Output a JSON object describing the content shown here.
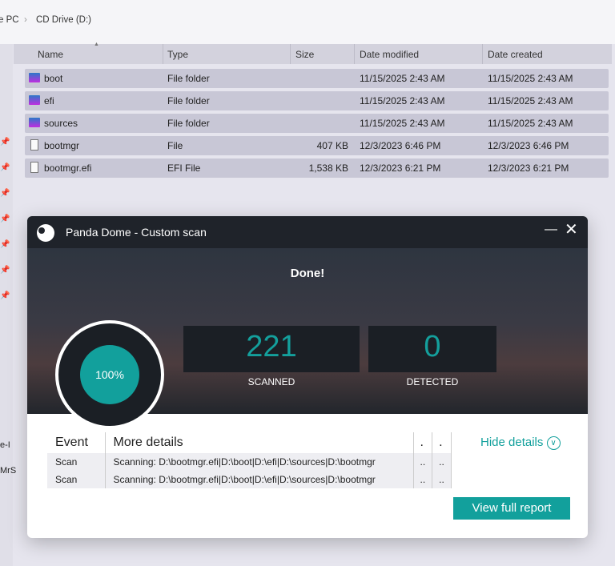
{
  "breadcrumb": [
    "e PC",
    "CD Drive (D:)"
  ],
  "columns": [
    "Name",
    "Type",
    "Size",
    "Date modified",
    "Date created"
  ],
  "files": [
    {
      "name": "boot",
      "type": "File folder",
      "size": "",
      "modified": "11/15/2025 2:43 AM",
      "created": "11/15/2025 2:43 AM",
      "icon": "folder-icon"
    },
    {
      "name": "efi",
      "type": "File folder",
      "size": "",
      "modified": "11/15/2025 2:43 AM",
      "created": "11/15/2025 2:43 AM",
      "icon": "folder-icon"
    },
    {
      "name": "sources",
      "type": "File folder",
      "size": "",
      "modified": "11/15/2025 2:43 AM",
      "created": "11/15/2025 2:43 AM",
      "icon": "folder-icon"
    },
    {
      "name": "bootmgr",
      "type": "File",
      "size": "407 KB",
      "modified": "12/3/2023 6:46 PM",
      "created": "12/3/2023 6:46 PM",
      "icon": "file-icon"
    },
    {
      "name": "bootmgr.efi",
      "type": "EFI File",
      "size": "1,538 KB",
      "modified": "12/3/2023 6:21 PM",
      "created": "12/3/2023 6:21 PM",
      "icon": "file-icon"
    }
  ],
  "sidebar_fragments": [
    "e-I",
    "MrS"
  ],
  "dialog": {
    "title": "Panda Dome - Custom scan",
    "status": "Done!",
    "progress": "100%",
    "scanned": "221",
    "scanned_label": "SCANNED",
    "detected": "0",
    "detected_label": "DETECTED",
    "hide_details": "Hide details",
    "table_headers": [
      "Event",
      "More details",
      ".",
      "."
    ],
    "events": [
      {
        "event": "Scan",
        "details": "Scanning: D:\\bootmgr.efi|D:\\boot|D:\\efi|D:\\sources|D:\\bootmgr",
        "c3": "..",
        "c4": ".."
      },
      {
        "event": "Scan",
        "details": "Scanning: D:\\bootmgr.efi|D:\\boot|D:\\efi|D:\\sources|D:\\bootmgr",
        "c3": "..",
        "c4": ".."
      }
    ],
    "button": "View full report",
    "accent": "#12a09c"
  }
}
